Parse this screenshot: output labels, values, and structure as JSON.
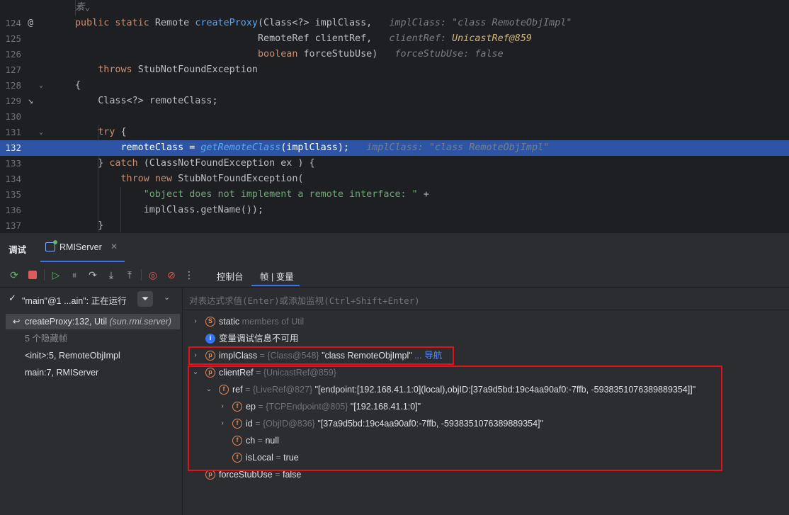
{
  "editor": {
    "lines": [
      {
        "num": "",
        "mark": "",
        "fold": "",
        "code": [
          {
            "c": "hint",
            "t": "素⌄"
          }
        ]
      },
      {
        "num": "124",
        "mark": "@",
        "fold": "",
        "code": [
          {
            "c": "kw",
            "t": "public static "
          },
          {
            "c": "plain",
            "t": "Remote "
          },
          {
            "c": "fn",
            "t": "createProxy"
          },
          {
            "c": "plain",
            "t": "(Class<?> implClass,   "
          },
          {
            "c": "hint",
            "t": "implClass: \"class RemoteObjImpl\""
          }
        ]
      },
      {
        "num": "125",
        "mark": "",
        "fold": "",
        "code": [
          {
            "c": "plain",
            "t": "                                RemoteRef clientRef,   "
          },
          {
            "c": "hint",
            "t": "clientRef: "
          },
          {
            "c": "hint-warn",
            "t": "UnicastRef@859"
          }
        ]
      },
      {
        "num": "126",
        "mark": "",
        "fold": "",
        "code": [
          {
            "c": "kw",
            "t": "                                boolean "
          },
          {
            "c": "plain",
            "t": "forceStubUse)   "
          },
          {
            "c": "hint",
            "t": "forceStubUse: false"
          }
        ]
      },
      {
        "num": "127",
        "mark": "",
        "fold": "",
        "code": [
          {
            "c": "kw",
            "t": "    throws "
          },
          {
            "c": "plain",
            "t": "StubNotFoundException"
          }
        ]
      },
      {
        "num": "128",
        "mark": "",
        "fold": "⌄",
        "code": [
          {
            "c": "plain",
            "t": "{"
          }
        ]
      },
      {
        "num": "129",
        "mark": "↘",
        "fold": "",
        "code": [
          {
            "c": "plain",
            "t": "    Class<?> remoteClass;"
          }
        ]
      },
      {
        "num": "130",
        "mark": "",
        "fold": "",
        "code": []
      },
      {
        "num": "131",
        "mark": "",
        "fold": "⌄",
        "code": [
          {
            "c": "kw",
            "t": "    try "
          },
          {
            "c": "plain",
            "t": "{"
          }
        ]
      },
      {
        "num": "132",
        "mark": "",
        "fold": "",
        "current": true,
        "code": [
          {
            "c": "plain",
            "t": "        remoteClass = "
          },
          {
            "c": "fn-it",
            "t": "getRemoteClass"
          },
          {
            "c": "plain",
            "t": "(implClass);   "
          },
          {
            "c": "hint",
            "t": "implClass: \"class RemoteObjImpl\""
          }
        ]
      },
      {
        "num": "133",
        "mark": "",
        "fold": "",
        "code": [
          {
            "c": "plain",
            "t": "    } "
          },
          {
            "c": "kw",
            "t": "catch "
          },
          {
            "c": "plain",
            "t": "(ClassNotFoundException ex ) {"
          }
        ]
      },
      {
        "num": "134",
        "mark": "",
        "fold": "",
        "code": [
          {
            "c": "kw",
            "t": "        throw new "
          },
          {
            "c": "plain",
            "t": "StubNotFoundException("
          }
        ]
      },
      {
        "num": "135",
        "mark": "",
        "fold": "",
        "code": [
          {
            "c": "str",
            "t": "            \"object does not implement a remote interface: \" "
          },
          {
            "c": "plain",
            "t": "+"
          }
        ]
      },
      {
        "num": "136",
        "mark": "",
        "fold": "",
        "code": [
          {
            "c": "plain",
            "t": "            implClass.getName());"
          }
        ]
      },
      {
        "num": "137",
        "mark": "",
        "fold": "",
        "code": [
          {
            "c": "plain",
            "t": "    }"
          }
        ]
      }
    ]
  },
  "debug": {
    "title": "调试",
    "run_tab": "RMIServer",
    "close_glyph": "✕",
    "views": [
      "控制台",
      "帧 | 变量"
    ],
    "toolbar_icons": [
      "rerun-icon",
      "stop-icon",
      "resume-icon",
      "pause-icon",
      "step-over-icon",
      "step-into-icon",
      "step-out-icon",
      "view-breakpoints-icon",
      "mute-breakpoints-icon",
      "more-icon"
    ],
    "thread_label": "\"main\"@1 ...ain\": 正在运行",
    "frames": [
      {
        "text": "createProxy:132, Util ",
        "pkg": "(sun.rmi.server)",
        "selected": true
      },
      {
        "text": "5 个隐藏帧",
        "dim": true
      },
      {
        "text": "<init>:5, RemoteObjImpl"
      },
      {
        "text": "main:7, RMIServer"
      }
    ],
    "eval_placeholder": "对表达式求值(Enter)或添加监视(Ctrl+Shift+Enter)",
    "variables": [
      {
        "arrow": "›",
        "icon": "S",
        "name": "static",
        "type": " members of Util",
        "value": ""
      },
      {
        "arrow": "",
        "icon": "i",
        "name": "变量调试信息不可用",
        "type": "",
        "value": ""
      },
      {
        "arrow": "›",
        "icon": "p",
        "name": "implClass",
        "type": " = {Class@548} ",
        "value": "\"class RemoteObjImpl\"",
        "link": " ... 导航"
      },
      {
        "arrow": "⌄",
        "icon": "p",
        "name": "clientRef",
        "type": " = {UnicastRef@859}",
        "value": ""
      },
      {
        "arrow": "⌄",
        "icon": "f",
        "name": "ref",
        "type": " = {LiveRef@827} ",
        "value": "\"[endpoint:[192.168.41.1:0](local),objID:[37a9d5bd:19c4aa90af0:-7ffb, -5938351076389889354]]\""
      },
      {
        "arrow": "›",
        "icon": "f",
        "name": "ep",
        "type": " = {TCPEndpoint@805} ",
        "value": "\"[192.168.41.1:0]\""
      },
      {
        "arrow": "›",
        "icon": "f",
        "name": "id",
        "type": " = {ObjID@836} ",
        "value": "\"[37a9d5bd:19c4aa90af0:-7ffb, -5938351076389889354]\""
      },
      {
        "arrow": "",
        "icon": "f",
        "name": "ch",
        "type": " = ",
        "value": "null"
      },
      {
        "arrow": "",
        "icon": "f",
        "name": "isLocal",
        "type": " = ",
        "value": "true"
      },
      {
        "arrow": "",
        "icon": "p",
        "name": "forceStubUse",
        "type": " = ",
        "value": "false"
      }
    ]
  }
}
